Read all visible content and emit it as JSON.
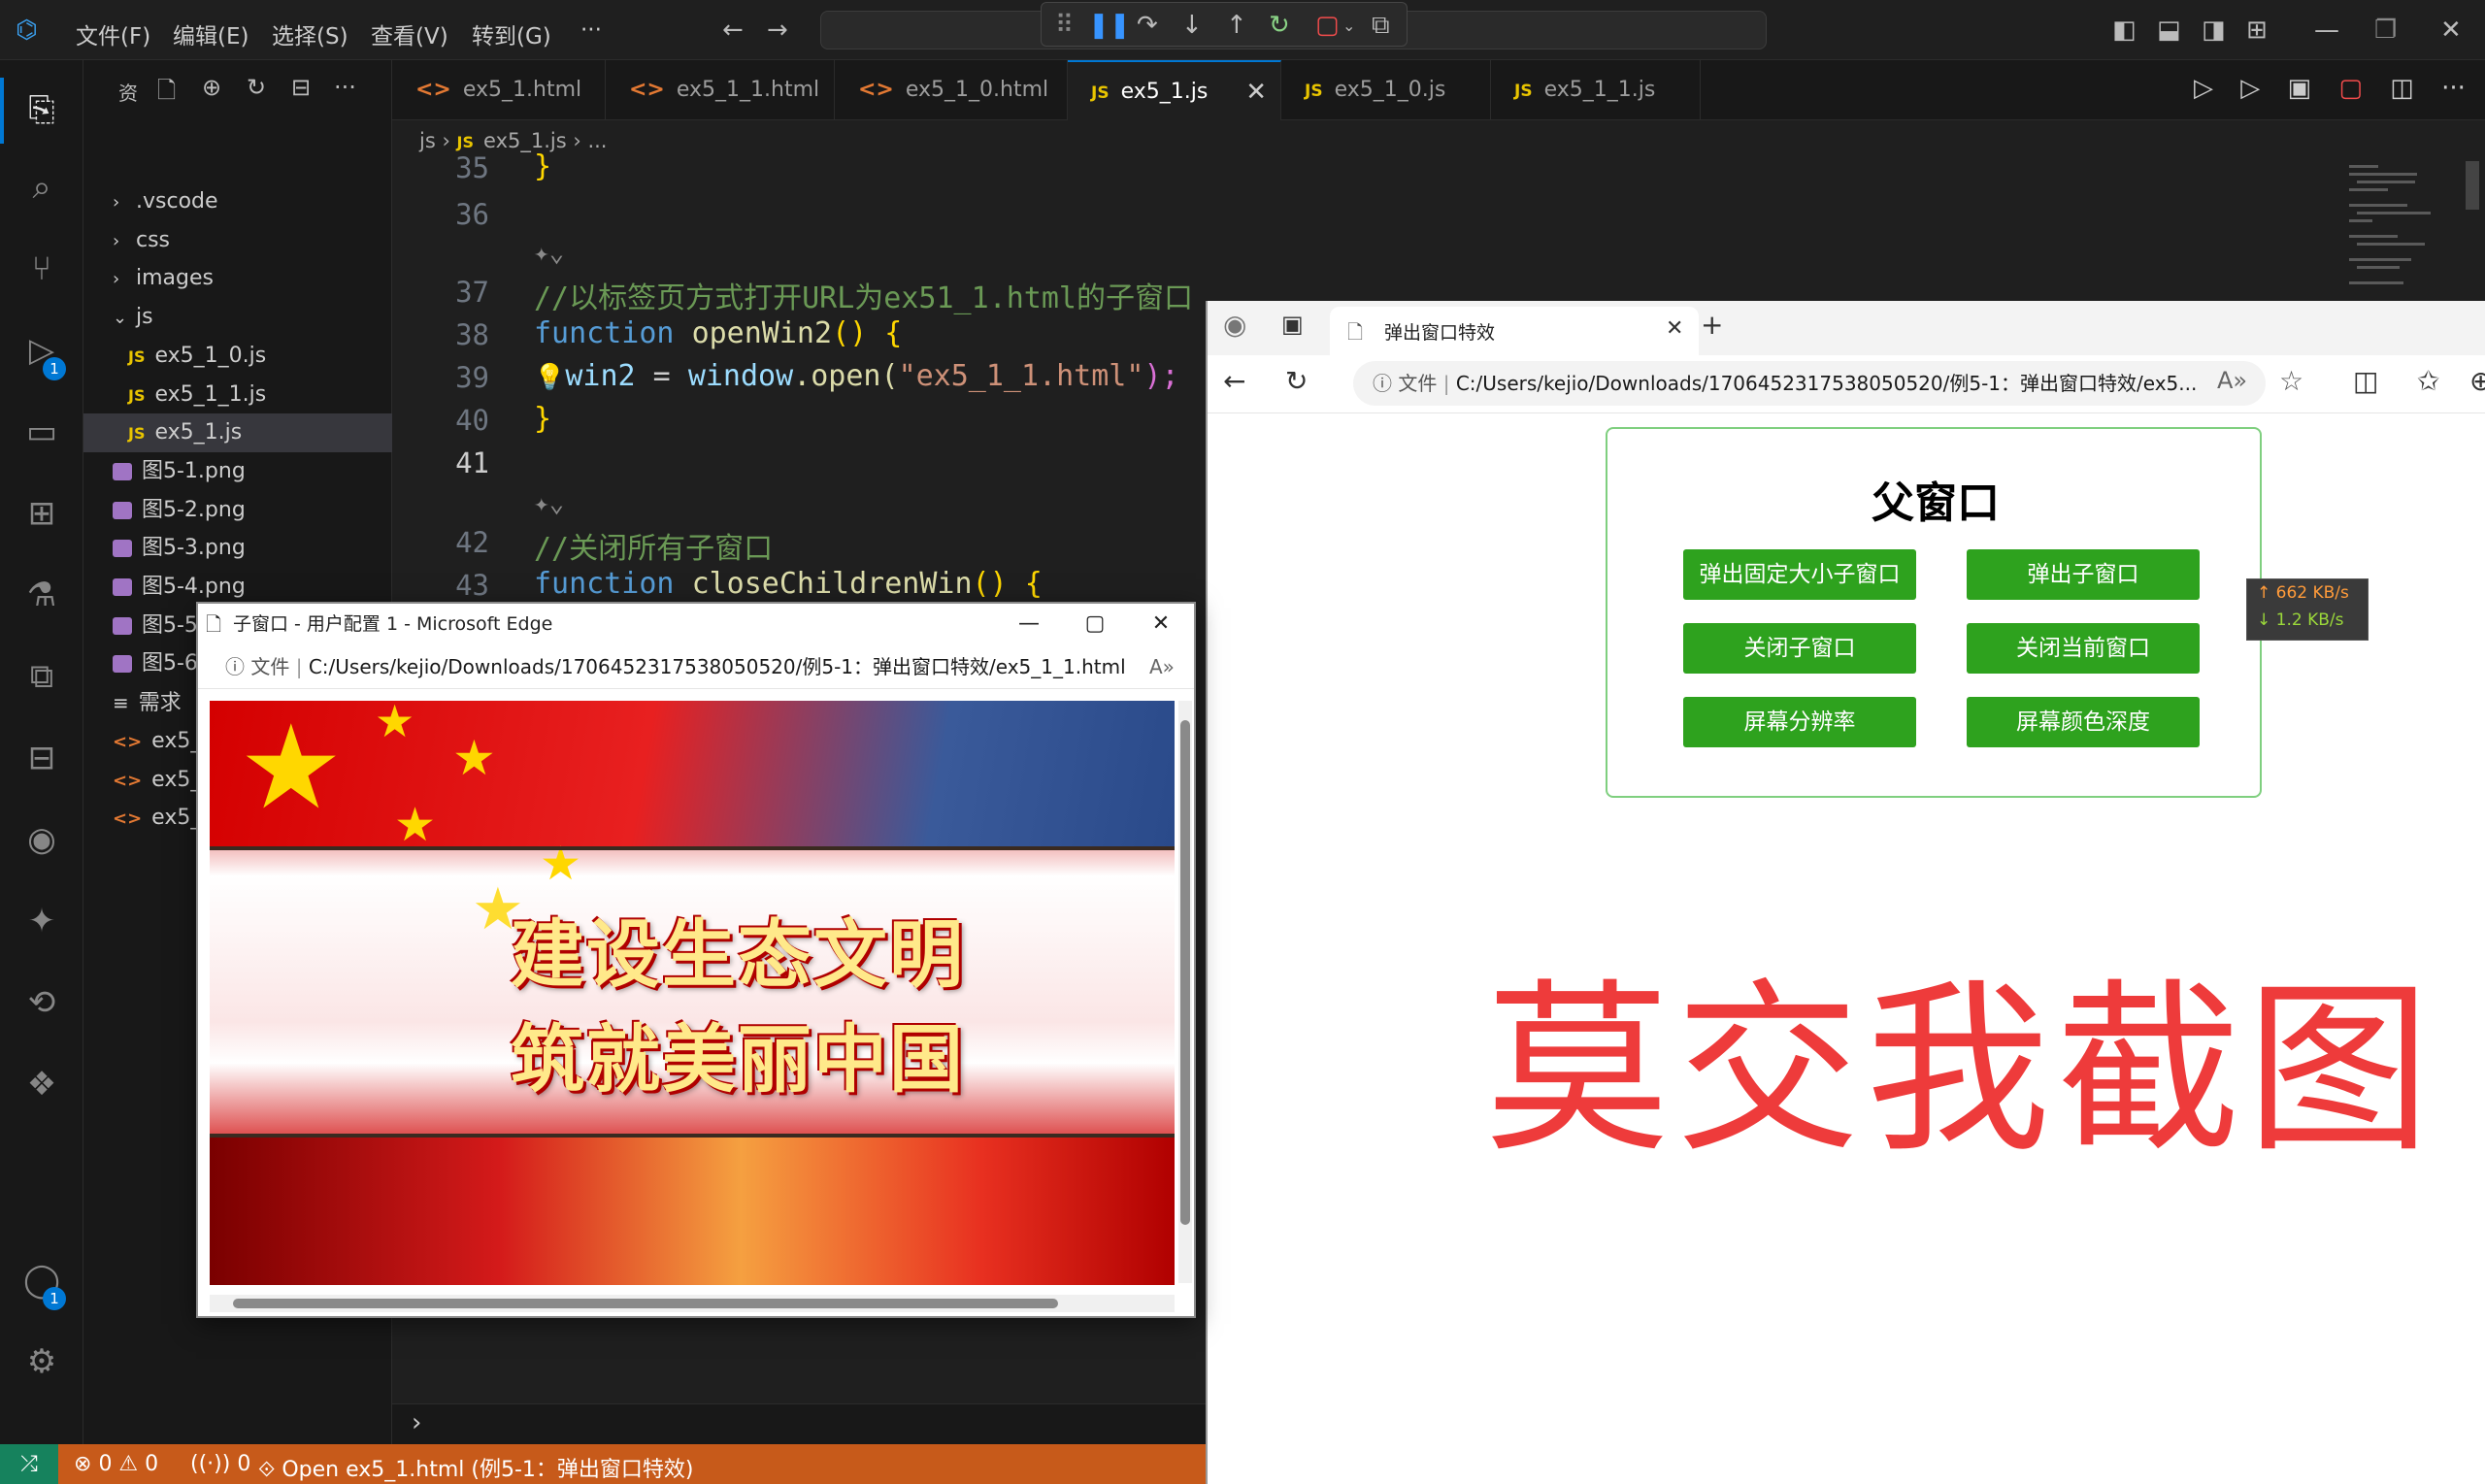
{
  "vscode": {
    "menu": [
      "文件(F)",
      "编辑(E)",
      "选择(S)",
      "查看(V)",
      "转到(G)",
      "···"
    ],
    "activity_badges": {
      "debug": "1",
      "account": "1"
    },
    "sidebar": {
      "tree": [
        {
          "label": ".vscode",
          "kind": "folder",
          "expanded": false
        },
        {
          "label": "css",
          "kind": "folder",
          "expanded": false
        },
        {
          "label": "images",
          "kind": "folder",
          "expanded": false
        },
        {
          "label": "js",
          "kind": "folder",
          "expanded": true
        },
        {
          "label": "ex5_1_0.js",
          "kind": "js"
        },
        {
          "label": "ex5_1_1.js",
          "kind": "js"
        },
        {
          "label": "ex5_1.js",
          "kind": "js",
          "selected": true
        },
        {
          "label": "图5-1.png",
          "kind": "img"
        },
        {
          "label": "图5-2.png",
          "kind": "img"
        },
        {
          "label": "图5-3.png",
          "kind": "img"
        },
        {
          "label": "图5-4.png",
          "kind": "img"
        },
        {
          "label": "图5-5.png",
          "kind": "img"
        },
        {
          "label": "图5-6",
          "kind": "img"
        },
        {
          "label": "需求",
          "kind": "md"
        },
        {
          "label": "ex5_1",
          "kind": "html"
        },
        {
          "label": "ex5_1",
          "kind": "html"
        },
        {
          "label": "ex5_1",
          "kind": "html"
        }
      ]
    },
    "tabs": [
      {
        "label": "ex5_1.html",
        "kind": "html"
      },
      {
        "label": "ex5_1_1.html",
        "kind": "html"
      },
      {
        "label": "ex5_1_0.html",
        "kind": "html"
      },
      {
        "label": "ex5_1.js",
        "kind": "js",
        "active": true
      },
      {
        "label": "ex5_1_0.js",
        "kind": "js"
      },
      {
        "label": "ex5_1_1.js",
        "kind": "js"
      }
    ],
    "breadcrumb": {
      "folder": "js",
      "file": "ex5_1.js",
      "rest": "..."
    },
    "code": {
      "line_numbers": [
        "35",
        "36",
        "37",
        "38",
        "39",
        "40",
        "41",
        "42",
        "43"
      ],
      "l35": "}",
      "l37": "//以标签页方式打开URL为ex51_1.html的子窗口",
      "l38_kw": "function",
      "l38_fn": "openWin2",
      "l38_rest": "() {",
      "l39_var": "win2",
      "l39_eq": " = ",
      "l39_obj": "window",
      "l39_fn": ".open(",
      "l39_str": "\"ex5_1_1.html\"",
      "l39_end": ");",
      "l40": "}",
      "l42": "//关闭所有子窗口",
      "l43_kw": "function",
      "l43_fn": "closeChildrenWin",
      "l43_rest": "() {"
    },
    "status": {
      "errors": "0",
      "warnings": "0",
      "ports": "0",
      "task": "Open ex5_1.html (例5-1：弹出窗口特效)"
    }
  },
  "edge_parent": {
    "tab_title": "弹出窗口特效",
    "url_prefix": "文件",
    "url": "C:/Users/kejio/Downloads/1706452317538050520/例5-1：弹出窗口特效/ex5...",
    "heading": "父窗口",
    "buttons": [
      "弹出固定大小子窗口",
      "弹出子窗口",
      "关闭子窗口",
      "关闭当前窗口",
      "屏幕分辨率",
      "屏幕颜色深度"
    ],
    "watermark": "莫交我截图"
  },
  "netspeed": {
    "up": "↑ 662 KB/s",
    "down": "↓ 1.2 KB/s"
  },
  "child_window": {
    "title": "子窗口 - 用户配置 1 - Microsoft Edge",
    "url_prefix": "文件",
    "url": "C:/Users/kejio/Downloads/1706452317538050520/例5-1：弹出窗口特效/ex5_1_1.html",
    "banner_line1": "建设生态文明",
    "banner_line2": "筑就美丽中国"
  },
  "colors": {
    "accent": "#0078d4",
    "status_bar": "#c75a1a",
    "button_green": "#2ea21e",
    "watermark_red": "#ee3b3b"
  }
}
